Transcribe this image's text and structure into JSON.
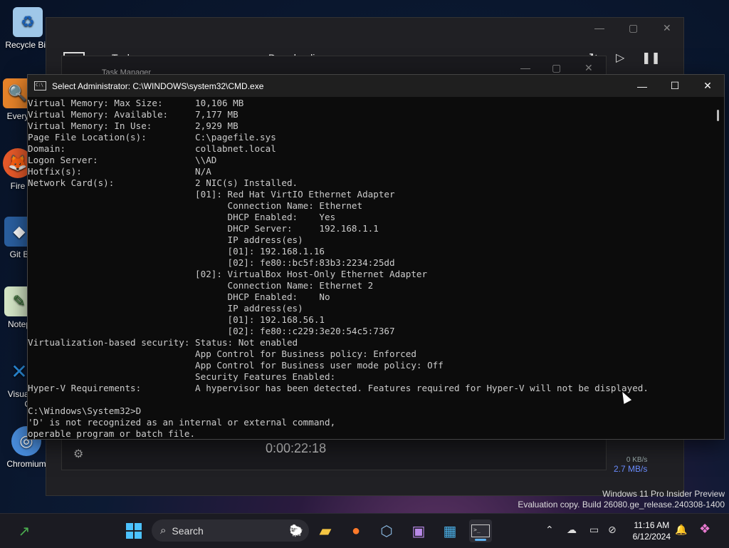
{
  "desktop": {
    "icons": [
      {
        "label": "Recycle Bin",
        "icon": "recycle-bin-icon"
      },
      {
        "label": "Every",
        "icon": "everything-icon"
      },
      {
        "label": "Fire",
        "icon": "firefox-icon"
      },
      {
        "label": "Git B",
        "icon": "git-icon"
      },
      {
        "label": "Notep",
        "icon": "notepad-icon"
      },
      {
        "label": "Visual",
        "label2": "Co",
        "icon": "vscode-icon"
      },
      {
        "label": "Chromium",
        "icon": "chromium-icon"
      }
    ]
  },
  "background_windows": {
    "task_manager_title": "Task Manager",
    "tasks_heading": "Tasks",
    "downloading_heading": "Downloading",
    "elapsed": "0:00:22:18",
    "speed_small": "0 KB/s",
    "speed_big": "2.7 MB/s"
  },
  "cmd": {
    "title": "Select Administrator: C:\\WINDOWS\\system32\\CMD.exe",
    "lines": [
      "Virtual Memory: Max Size:      10,106 MB",
      "Virtual Memory: Available:     7,177 MB",
      "Virtual Memory: In Use:        2,929 MB",
      "Page File Location(s):         C:\\pagefile.sys",
      "Domain:                        collabnet.local",
      "Logon Server:                  \\\\AD",
      "Hotfix(s):                     N/A",
      "Network Card(s):               2 NIC(s) Installed.",
      "                               [01]: Red Hat VirtIO Ethernet Adapter",
      "                                     Connection Name: Ethernet",
      "                                     DHCP Enabled:    Yes",
      "                                     DHCP Server:     192.168.1.1",
      "                                     IP address(es)",
      "                                     [01]: 192.168.1.16",
      "                                     [02]: fe80::bc5f:83b3:2234:25dd",
      "                               [02]: VirtualBox Host-Only Ethernet Adapter",
      "                                     Connection Name: Ethernet 2",
      "                                     DHCP Enabled:    No",
      "                                     IP address(es)",
      "                                     [01]: 192.168.56.1",
      "                                     [02]: fe80::c229:3e20:54c5:7367",
      "Virtualization-based security: Status: Not enabled",
      "                               App Control for Business policy: Enforced",
      "                               App Control for Business user mode policy: Off",
      "                               Security Features Enabled:",
      "Hyper-V Requirements:          A hypervisor has been detected. Features required for Hyper-V will not be displayed.",
      "",
      "C:\\Windows\\System32>D",
      "'D' is not recognized as an internal or external command,",
      "operable program or batch file."
    ]
  },
  "watermark": {
    "line1": "Windows 11 Pro Insider Preview",
    "line2": "Evaluation copy. Build 26080.ge_release.240308-1400"
  },
  "taskbar": {
    "search_placeholder": "Search",
    "time": "11:16 AM",
    "date": "6/12/2024",
    "colors": {
      "accent": "#5fb2f2",
      "bg": "#1b1b22"
    }
  }
}
